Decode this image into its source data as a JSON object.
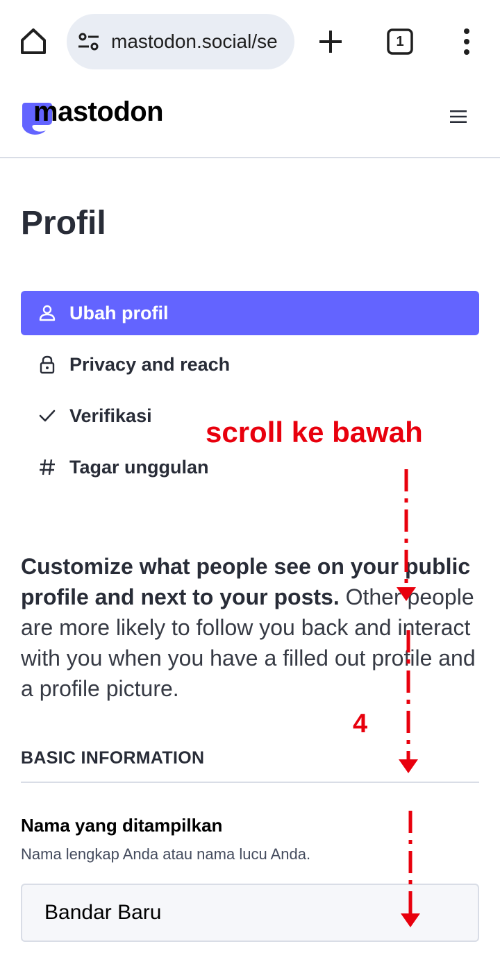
{
  "browser": {
    "url": "mastodon.social/se",
    "tab_count": "1",
    "icons": [
      "home-icon",
      "site-settings-icon",
      "plus-icon",
      "tab-switcher-icon",
      "overflow-menu-icon"
    ]
  },
  "site": {
    "logo_text": "mastodon",
    "brand_color": "#6364ff"
  },
  "page": {
    "title": "Profil",
    "nav": [
      {
        "label": "Ubah profil",
        "icon": "person-icon",
        "active": true
      },
      {
        "label": "Privacy and reach",
        "icon": "lock-icon",
        "active": false
      },
      {
        "label": "Verifikasi",
        "icon": "check-icon",
        "active": false
      },
      {
        "label": "Tagar unggulan",
        "icon": "hashtag-icon",
        "active": false
      }
    ],
    "intro_bold": "Customize what people see on your public profile and next to your posts.",
    "intro_rest": " Other people are more likely to follow you back and interact with you when you have a filled out profile and a profile picture."
  },
  "form": {
    "section_title": "BASIC INFORMATION",
    "display_name": {
      "label": "Nama yang ditampilkan",
      "hint": "Nama lengkap Anda atau nama lucu Anda.",
      "value": "Bandar Baru"
    }
  },
  "annotation": {
    "text": "scroll ke bawah",
    "step": "4",
    "color": "#e8000d"
  }
}
